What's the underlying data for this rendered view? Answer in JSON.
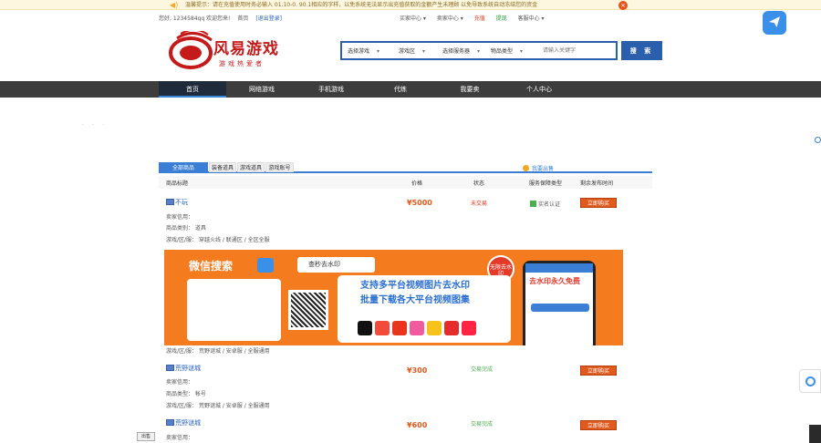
{
  "notice": {
    "text": "温馨提示：请在充值使用时务必输入 01.10-0. 90.1相应的字样，以免系统无法显示出充值获取的金额产生未理顾 以免导致系统自动冻结您的资金"
  },
  "toplinks": {
    "greeting": "您好, 1234584qq 欢迎您来!",
    "home": "首页",
    "logout": "[退出登录]",
    "buyer_center": "买家中心 ▾",
    "seller_center": "卖家中心 ▾",
    "recharge": "充值",
    "withdraw": "提现",
    "service": "客服中心 ▾"
  },
  "logo": {
    "brand": "风易游戏",
    "slogan": "游戏热爱者"
  },
  "search": {
    "game_select": "选择游戏",
    "area_select": "游戏区",
    "server_select": "选择服务器",
    "type_select": "物品类型",
    "placeholder": "请输入关键字",
    "button": "搜 索"
  },
  "nav": {
    "items": [
      "首页",
      "网络游戏",
      "手机游戏",
      "代练",
      "我要卖",
      "个人中心"
    ]
  },
  "dots": "· · ·",
  "tabs": {
    "items": [
      "全部商品",
      "装备道具",
      "游戏道具",
      "游戏账号"
    ],
    "publish": "我要出售"
  },
  "table": {
    "headers": {
      "title": "商品标题",
      "price": "价格",
      "status": "状态",
      "guarantee": "服务保障类型",
      "time": "剩余发布时间"
    }
  },
  "listings": [
    {
      "title": "不玩",
      "seller": "卖家信用：",
      "category": "商品类别：  道具",
      "server": "游戏/区/服：  穿越火线 / 联通区 / 全区全服",
      "price": "¥5000",
      "status": "未交易",
      "cert": "实名认证",
      "buy": "立即购买"
    },
    {
      "title": "荒野谜城",
      "seller": "卖家信用：",
      "category": "商品类型：  帐号",
      "server": "游戏/区/服：  荒野谜城 / 安卓服 / 全服通用",
      "price": "¥300",
      "status": "交易完成",
      "buy": "立即购买"
    },
    {
      "title": "荒野谜城",
      "seller": "卖家信用：",
      "price": "¥600",
      "status": "交易完成",
      "buy": "立即购买"
    }
  ],
  "ad_server_line": "游戏/区/服：  荒野谜城 / 安卓服 / 全服通用",
  "ad": {
    "wechat": "微信搜索",
    "search_text": "查秒去水印",
    "badge": "无限去水印",
    "line1": "支持多平台视频图片去水印",
    "line2": "批量下载各大平台视频图集",
    "free": "去水印永久免费"
  },
  "out_button": "出售",
  "colors": {
    "accent": "#2b5fab",
    "nav": "#3d3d3d",
    "price": "#e05a1e",
    "ad": "#f57c1e"
  }
}
